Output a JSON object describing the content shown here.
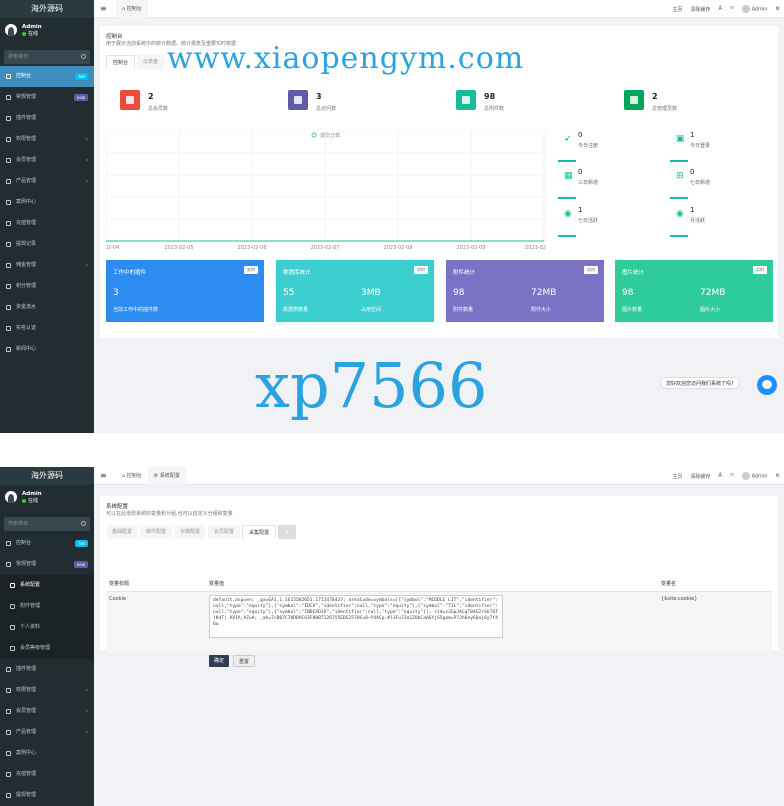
{
  "panel1": {
    "sidebar": {
      "logo": "海外源码",
      "user_name": "Admin",
      "user_status": "在线",
      "search_placeholder": "搜索菜单",
      "items": [
        {
          "label": "控制台",
          "badge": "hot",
          "badge_color": "#00c0ef",
          "active": true
        },
        {
          "label": "常规管理",
          "badge": "new",
          "badge_color": "#605ca8",
          "arrow": ""
        },
        {
          "label": "插件管理"
        },
        {
          "label": "权限管理",
          "arrow": "‹"
        },
        {
          "label": "会员管理",
          "arrow": "‹"
        },
        {
          "label": "产品管理",
          "arrow": "‹"
        },
        {
          "label": "案例中心"
        },
        {
          "label": "充值管理"
        },
        {
          "label": "提现记录"
        },
        {
          "label": "佣金管理",
          "arrow": "‹"
        },
        {
          "label": "积分管理"
        },
        {
          "label": "资金流水"
        },
        {
          "label": "实名认证"
        },
        {
          "label": "新闻中心"
        }
      ]
    },
    "topbar": {
      "tab": "控制台",
      "right": [
        "主页",
        "清除缓存",
        "Ā",
        "⤧",
        "Admin"
      ]
    },
    "content": {
      "title": "控制台",
      "desc": "用于展示当前系统中的统计数据、统计报表及重要实时数据",
      "tabs": [
        "控制台",
        "仪表盘"
      ],
      "stats": [
        {
          "value": "2",
          "label": "总会员数",
          "color": "#e74c3c"
        },
        {
          "value": "3",
          "label": "总访问数",
          "color": "#605ca8"
        },
        {
          "value": "98",
          "label": "总附件数",
          "color": "#18bc9c"
        },
        {
          "value": "2",
          "label": "总管理员数",
          "color": "#00a65a"
        }
      ],
      "chart_legend": "成交订单",
      "chart_x": [
        "02-04",
        "2023-02-05",
        "2023-02-06",
        "2023-02-07",
        "2023-02-08",
        "2023-02-09",
        "2023-02-1"
      ],
      "small_stats": [
        {
          "value": "0",
          "label": "今日注册",
          "icon": "rocket-icon"
        },
        {
          "value": "1",
          "label": "今日登录",
          "icon": "id-card-icon"
        },
        {
          "value": "0",
          "label": "三日新增",
          "icon": "calendar-icon"
        },
        {
          "value": "0",
          "label": "七日新增",
          "icon": "calendar-plus-icon"
        },
        {
          "value": "1",
          "label": "七日活跃",
          "icon": "user-circle-icon"
        },
        {
          "value": "1",
          "label": "月活跃",
          "icon": "user-circle-icon"
        }
      ],
      "cards": [
        {
          "title": "工作中的插件",
          "tag": "实时",
          "v1": "3",
          "v2": "",
          "s1": "当前工作中的插件数",
          "s2": "",
          "color": "#2d8cf0"
        },
        {
          "title": "数据库统计",
          "tag": "实时",
          "v1": "55",
          "v2": "3MB",
          "s1": "数据表数量",
          "s2": "占用空间",
          "color": "#3ccfcf"
        },
        {
          "title": "附件统计",
          "tag": "实时",
          "v1": "98",
          "v2": "72MB",
          "s1": "附件数量",
          "s2": "附件大小",
          "color": "#7b72c6"
        },
        {
          "title": "图片统计",
          "tag": "实时",
          "v1": "98",
          "v2": "72MB",
          "s1": "图片数量",
          "s2": "图片大小",
          "color": "#2ecc9a"
        }
      ]
    },
    "watermark_url": "www.xiaopengym.com",
    "watermark_text": "xp7566",
    "chat_text": "您好欢迎您访问我们系统了吗?"
  },
  "panel2": {
    "sidebar": {
      "logo": "海外源码",
      "user_name": "Admin",
      "user_status": "在线",
      "search_placeholder": "搜索菜单",
      "items": [
        {
          "label": "控制台",
          "badge": "hot",
          "badge_color": "#00c0ef"
        },
        {
          "label": "常规管理",
          "badge": "new",
          "badge_color": "#605ca8"
        },
        {
          "label": "系统配置",
          "active": true,
          "sub": true
        },
        {
          "label": "附件管理",
          "sub": true
        },
        {
          "label": "个人资料",
          "sub": true
        },
        {
          "label": "会员等级管理",
          "sub": true
        },
        {
          "label": "插件管理"
        },
        {
          "label": "权限管理",
          "arrow": "‹"
        },
        {
          "label": "会员管理",
          "arrow": "‹"
        },
        {
          "label": "产品管理",
          "arrow": "‹"
        },
        {
          "label": "案例中心"
        },
        {
          "label": "充值管理"
        },
        {
          "label": "提现管理"
        }
      ]
    },
    "topbar": {
      "tabs": [
        "控制台",
        "系统配置"
      ],
      "right": [
        "主页",
        "清除缓存",
        "Ā",
        "⤧",
        "Admin"
      ]
    },
    "content": {
      "title": "系统配置",
      "desc": "可以在此增改系统的变量和分组,也可以自定义分组和变量",
      "tabs": [
        "基础配置",
        "邮件配置",
        "字典配置",
        "会员配置",
        "采集配置"
      ],
      "table_headers": [
        "变量标题",
        "变量值",
        "变量名"
      ],
      "row": {
        "title": "Cookie",
        "value": "default.asp=en; _ga=GA1.1.1615502051.1711478437; areaCode=symbols=[{\"symbol\":\"MIDDLE LIT\",\"identifier\":null,\"type\":\"equity\"},{\"symbol\":\"IDCA\",\"identifier\":null,\"type\":\"equity\"},{\"symbol\":\"TIL\",\"identifier\":null,\"type\":\"equity\"},{\"symbol\":\"INDEXDJU\",\"identifier\":null,\"type\":\"equity\"}]; cid=s2GpJACqT04G2rSkT6T(KdT) AVIA_AZ=A; _ab=7cB07C70DBAC63F00B7126755EDS2570C=8~Y4ACp.#l1Fu73a1ZOkCaA6YjS5gam=P7Jh6ey6Quj6y7f46u",
        "name": "{$site.cookie}"
      },
      "confirm": "确定",
      "reset": "重置"
    }
  }
}
